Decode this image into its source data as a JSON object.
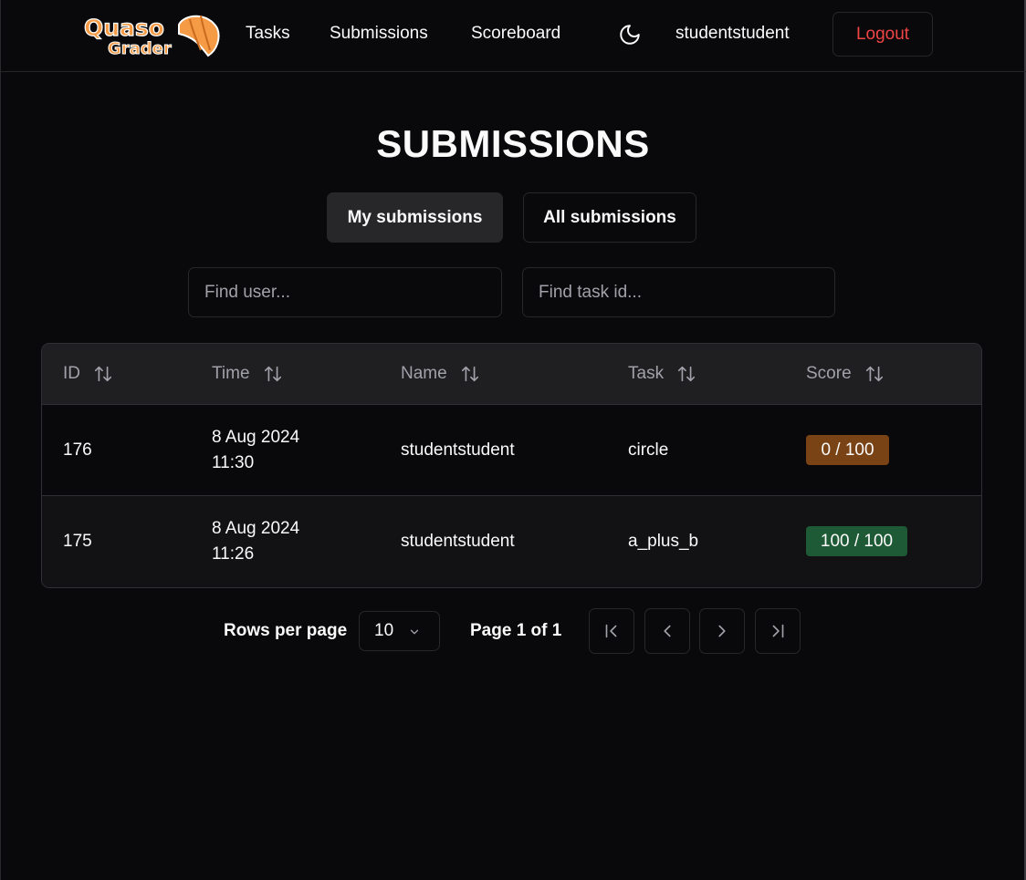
{
  "navbar": {
    "logo_text_top": "Quaso",
    "logo_text_bottom": "Grader",
    "links": [
      "Tasks",
      "Submissions",
      "Scoreboard"
    ],
    "theme_icon": "moon-icon",
    "username": "studentstudent",
    "logout_label": "Logout"
  },
  "page": {
    "title": "SUBMISSIONS",
    "toggle_my": "My submissions",
    "toggle_all": "All submissions",
    "find_user_placeholder": "Find user...",
    "find_task_placeholder": "Find task id..."
  },
  "table": {
    "columns": [
      "ID",
      "Time",
      "Name",
      "Task",
      "Score"
    ],
    "rows": [
      {
        "id": "176",
        "date": "8 Aug 2024",
        "time": "11:30",
        "name": "studentstudent",
        "task": "circle",
        "score": "0 / 100"
      },
      {
        "id": "175",
        "date": "8 Aug 2024",
        "time": "11:26",
        "name": "studentstudent",
        "task": "a_plus_b",
        "score": "100 / 100"
      }
    ]
  },
  "pagination": {
    "rows_per_page_label": "Rows per page",
    "rows_per_page_value": "10",
    "page_label": "Page 1 of 1"
  },
  "colors": {
    "background": "#09090b",
    "danger": "#ef4444",
    "score_zero": "#7a4315",
    "score_full": "#1e5a35",
    "logo_orange": "#f59a45"
  }
}
